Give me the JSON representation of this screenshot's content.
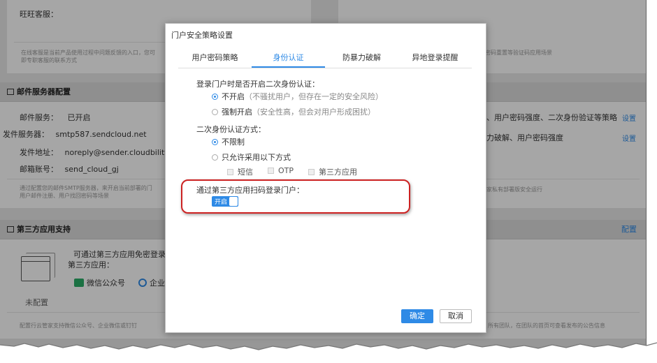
{
  "background": {
    "top_section": {
      "wangwang_label": "旺旺客服：",
      "note_left": "在线客服是当前产品使用过程中问题反馈的入口，您可",
      "note_left_2": "即专职客服的联系方式",
      "note_right": "密码重置等验证码应用场景"
    },
    "mail_server": {
      "title": "邮件服务器配置",
      "rows": [
        {
          "label": "邮件服务：",
          "value": "已开启"
        },
        {
          "label": "发件服务器：",
          "value": "smtp587.sendcloud.net"
        },
        {
          "label": "发件地址：",
          "value": "noreply@sender.cloudbility.co"
        },
        {
          "label": "邮箱账号：",
          "value": "send_cloud_gj"
        }
      ],
      "note_1": "通过配置您的邮件SMTP服务器，来开启当前部署的门",
      "note_2": "用户邮件注册、用户找回密码等场景"
    },
    "right_panel": {
      "line_1": "、用户密码强度、二次身份验证等策略",
      "line_1_link": "设置",
      "line_2": "力破解、用户密码强度",
      "line_2_link": "设置",
      "note": "家私有部署版安全运行"
    },
    "third_party": {
      "title": "第三方应用支持",
      "config_link": "配置",
      "desc_1": "可通过第三方应用免密登录，",
      "desc_2": "第三方应用：",
      "wechat": "微信公众号",
      "enterprise": "企业",
      "status": "未配置",
      "note": "配置行云管家支持微信公众号、企业微信或钉钉",
      "note_right": "所有团队，在团队的首页可查看发布的公告信息"
    }
  },
  "modal": {
    "title": "门户安全策略设置",
    "tabs": [
      {
        "label": "用户密码策略",
        "active": false
      },
      {
        "label": "身份认证",
        "active": true
      },
      {
        "label": "防暴力破解",
        "active": false
      },
      {
        "label": "异地登录提醒",
        "active": false
      }
    ],
    "q1": {
      "label": "登录门户时是否开启二次身份认证：",
      "options": [
        {
          "label": "不开启",
          "hint": "（不骚扰用户，但存在一定的安全风险）",
          "checked": true
        },
        {
          "label": "强制开启",
          "hint": "（安全性高，但会对用户形成困扰）",
          "checked": false
        }
      ]
    },
    "q2": {
      "label": "二次身份认证方式：",
      "options": [
        {
          "label": "不限制",
          "checked": true
        },
        {
          "label": "只允许采用以下方式",
          "checked": false
        }
      ],
      "methods": [
        "短信",
        "OTP",
        "第三方应用"
      ]
    },
    "q3": {
      "label": "通过第三方应用扫码登录门户：",
      "toggle_label": "开启",
      "toggle_on": true
    },
    "confirm_label": "确定",
    "cancel_label": "取消"
  },
  "colors": {
    "accent": "#2e8ae6",
    "highlight": "#cc2222"
  }
}
